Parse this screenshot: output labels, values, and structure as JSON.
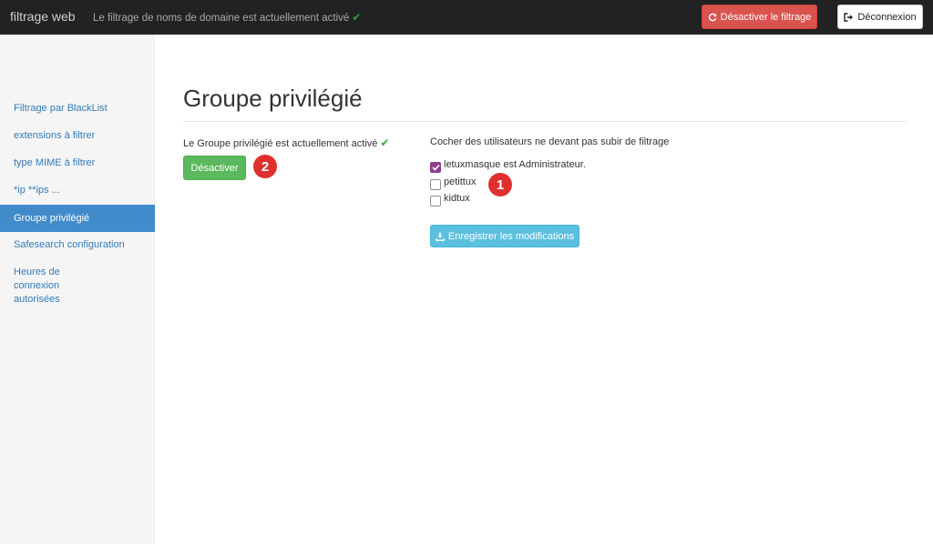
{
  "navbar": {
    "brand": "filtrage web",
    "status_text": "Le filtrage de noms de domaine est actuellement activé",
    "status_icon": "check-icon",
    "disable_filter_label": "Désactiver le filtrage",
    "logout_label": "Déconnexion"
  },
  "sidebar": {
    "items": [
      {
        "label": "Filtrage par BlackList"
      },
      {
        "label": "extensions à filtrer"
      },
      {
        "label": "type MIME à filtrer"
      },
      {
        "label": "*ip **ips ..."
      },
      {
        "label": "Groupe privilégié",
        "active": true
      },
      {
        "label": "Safesearch configuration"
      },
      {
        "label": "Heures de connexion autorisées"
      }
    ]
  },
  "main": {
    "title": "Groupe privilégié",
    "active_text": "Le Groupe privilégié est actuellement activé",
    "deactivate_label": "Désactiver",
    "instruction": "Cocher des utilisateurs ne devant pas subir de filtrage",
    "users": [
      {
        "label": "letuxmasque est Administrateur.",
        "checked": true
      },
      {
        "label": "petittux",
        "checked": false
      },
      {
        "label": "kidtux",
        "checked": false
      }
    ],
    "save_label": "Enregistrer les modifications"
  },
  "annotations": {
    "badge_1": "1",
    "badge_2": "2"
  },
  "colors": {
    "navbar_bg": "#222222",
    "danger": "#d9534f",
    "success": "#5cb85c",
    "info": "#5bc0de",
    "primary": "#428bca",
    "badge": "#e0302e",
    "checkbox_checked": "#8e3f8e"
  }
}
